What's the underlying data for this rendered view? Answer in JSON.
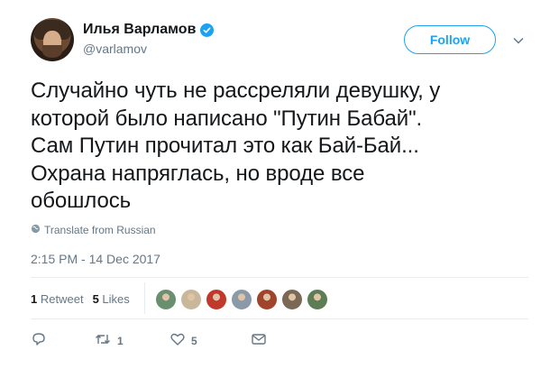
{
  "author": {
    "name": "Илья Варламов",
    "handle": "@varlamov",
    "verified": true
  },
  "follow_label": "Follow",
  "tweet": {
    "text": "Случайно чуть не рассреляли девушку, у\nкоторой было написано \"Путин Бабай\".\nСам Путин  прочитал это как Бай-Бай...\nОхрана напряглась, но вроде все\nобошлось",
    "translate_label": "Translate from Russian",
    "timestamp": "2:15 PM - 14 Dec 2017"
  },
  "stats": {
    "retweets_count": "1",
    "retweets_label": "Retweet",
    "likes_count": "5",
    "likes_label": "Likes"
  },
  "likers": [
    {
      "color": "#6a8f6f"
    },
    {
      "color": "#c9b79c"
    },
    {
      "color": "#c0392b"
    },
    {
      "color": "#8a9aa8"
    },
    {
      "color": "#a0442c"
    },
    {
      "color": "#7a6a55"
    },
    {
      "color": "#5d7d54"
    }
  ],
  "actions": {
    "reply_count": "",
    "retweet_count": "1",
    "like_count": "5"
  },
  "colors": {
    "accent": "#1da1f2",
    "secondary_text": "#657786"
  },
  "icons": [
    "reply-icon",
    "retweet-icon",
    "like-icon",
    "message-icon",
    "globe-icon",
    "chevron-down-icon",
    "verified-icon"
  ]
}
